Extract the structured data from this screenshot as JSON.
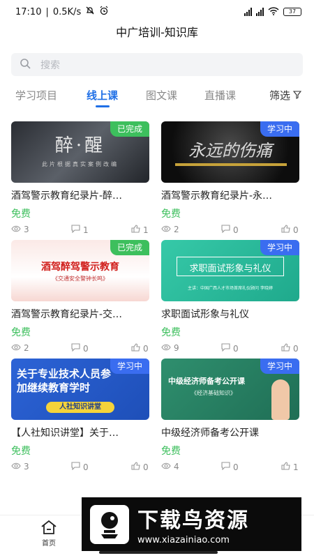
{
  "status_bar": {
    "time": "17:10",
    "speed": "0.5K/s",
    "battery": "37"
  },
  "header": {
    "title": "中广培训-知识库"
  },
  "search": {
    "placeholder": "搜索"
  },
  "tabs": [
    {
      "label": "学习项目",
      "active": false
    },
    {
      "label": "线上课",
      "active": true
    },
    {
      "label": "图文课",
      "active": false
    },
    {
      "label": "直播课",
      "active": false
    }
  ],
  "filter": {
    "label": "筛选"
  },
  "courses": [
    {
      "thumb_text": "醉·醒",
      "thumb_sub": "此片根据真实案例改编",
      "badge": "已完成",
      "title": "酒驾警示教育纪录片-醉…",
      "price": "免费",
      "views": "3",
      "comments": "1",
      "likes": "1"
    },
    {
      "thumb_text": "永远的伤痛",
      "thumb_sub": "",
      "badge": "学习中",
      "title": "酒驾警示教育纪录片-永…",
      "price": "免费",
      "views": "2",
      "comments": "0",
      "likes": "0"
    },
    {
      "thumb_text": "酒驾醉驾警示教育",
      "thumb_sub": "《交通安全警钟长鸣》",
      "badge": "已完成",
      "title": "酒驾警示教育纪录片-交…",
      "price": "免费",
      "views": "2",
      "comments": "0",
      "likes": "0"
    },
    {
      "thumb_text": "求职面试形象与礼仪",
      "thumb_sub": "主讲：中国广西人才市场首席礼仪顾问 李晓婷",
      "badge": "学习中",
      "title": "求职面试形象与礼仪",
      "price": "免费",
      "views": "9",
      "comments": "0",
      "likes": "0"
    },
    {
      "thumb_text": "关于专业技术人员参加继续教育学时",
      "thumb_sub": "人社知识讲堂",
      "badge": "学习中",
      "title": "【人社知识讲堂】关于…",
      "price": "免费",
      "views": "3",
      "comments": "0",
      "likes": "0"
    },
    {
      "thumb_text": "中级经济师备考公开课",
      "thumb_sub": "《经济基础知识》",
      "badge": "学习中",
      "title": "中级经济师备考公开课",
      "price": "免费",
      "views": "4",
      "comments": "0",
      "likes": "1"
    }
  ],
  "bottom_nav": {
    "home": "首页"
  },
  "watermark": {
    "title": "下载鸟资源",
    "url": "www.xiazainiao.com"
  },
  "colors": {
    "accent": "#1f6fe6",
    "done": "#3dbf5d",
    "learning": "#3a6df0",
    "price": "#3dbf5d"
  }
}
